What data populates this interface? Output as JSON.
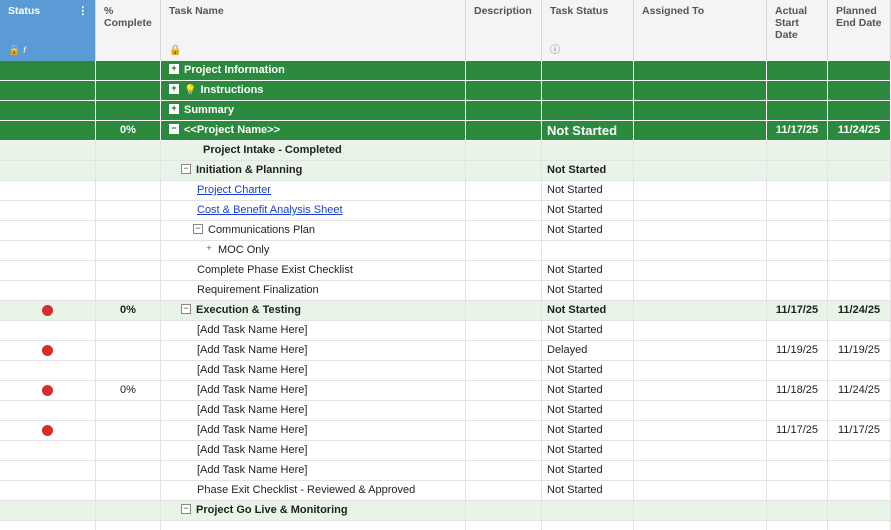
{
  "columns": {
    "status": "Status",
    "pct": "%\nComplete",
    "task": "Task Name",
    "desc": "Description",
    "task_status": "Task Status",
    "assigned": "Assigned To",
    "actual_start": "Actual\nStart\nDate",
    "planned_end": "Planned\nEnd Date"
  },
  "icons": {
    "status_menu": "more-vertical-icon",
    "lock": "lock-icon",
    "formula": "fx-icon",
    "info": "info-icon",
    "status_dot_color": "#d32f2f"
  },
  "colors": {
    "status_header": "#5b9bd5",
    "section_green": "#2b8a3e",
    "light_green": "#e8f4e8"
  },
  "rows": [
    {
      "style": "green",
      "indent": 0,
      "toggle": "+",
      "name": "Project Information",
      "bold": true,
      "status": "",
      "pct": "",
      "start": "",
      "end": ""
    },
    {
      "style": "green",
      "indent": 0,
      "toggle": "+",
      "bulb": true,
      "name": "Instructions",
      "bold": true,
      "status": "",
      "pct": "",
      "start": "",
      "end": ""
    },
    {
      "style": "green",
      "indent": 0,
      "toggle": "+",
      "name": "Summary",
      "bold": true,
      "status": "",
      "pct": "",
      "start": "",
      "end": ""
    },
    {
      "style": "green",
      "indent": 0,
      "toggle": "−",
      "name": "<<Project Name>>",
      "bold": true,
      "status": "Not Started",
      "status_big": true,
      "pct": "0%",
      "start": "11/17/25",
      "end": "11/24/25"
    },
    {
      "style": "light",
      "indent": 1,
      "toggle": "",
      "name": "Project Intake - Completed",
      "bold": true,
      "status": "",
      "pct": "",
      "start": "",
      "end": ""
    },
    {
      "style": "light",
      "indent": 1,
      "toggle": "−",
      "name": "Initiation & Planning",
      "bold": true,
      "status": "Not Started",
      "status_bold": true,
      "pct": "",
      "start": "",
      "end": ""
    },
    {
      "style": "white",
      "indent": 2,
      "toggle": "",
      "name": "Project Charter",
      "link": true,
      "status": "Not Started",
      "pct": "",
      "start": "",
      "end": ""
    },
    {
      "style": "white",
      "indent": 2,
      "toggle": "",
      "name": "Cost & Benefit Analysis Sheet",
      "link": true,
      "status": "Not Started",
      "pct": "",
      "start": "",
      "end": ""
    },
    {
      "style": "white",
      "indent": 2,
      "toggle": "−",
      "name": "Communications Plan",
      "status": "Not Started",
      "pct": "",
      "start": "",
      "end": ""
    },
    {
      "style": "white",
      "indent": 3,
      "toggle": "+",
      "toggle_plain": true,
      "name": "MOC Only",
      "status": "",
      "pct": "",
      "start": "",
      "end": ""
    },
    {
      "style": "white",
      "indent": 2,
      "toggle": "",
      "name": "Complete Phase Exist Checklist",
      "status": "Not Started",
      "pct": "",
      "start": "",
      "end": ""
    },
    {
      "style": "white",
      "indent": 2,
      "toggle": "",
      "name": "Requirement Finalization",
      "status": "Not Started",
      "pct": "",
      "start": "",
      "end": ""
    },
    {
      "style": "light",
      "indent": 1,
      "toggle": "−",
      "name": "Execution & Testing",
      "bold": true,
      "dot": true,
      "status": "Not Started",
      "status_bold": true,
      "pct": "0%",
      "pct_bold": true,
      "start": "11/17/25",
      "end": "11/24/25",
      "date_bold": true
    },
    {
      "style": "white",
      "indent": 2,
      "toggle": "",
      "name": "[Add Task Name Here]",
      "status": "Not Started",
      "pct": "",
      "start": "",
      "end": ""
    },
    {
      "style": "white",
      "indent": 2,
      "toggle": "",
      "name": "[Add Task Name Here]",
      "dot": true,
      "status": "Delayed",
      "pct": "",
      "start": "11/19/25",
      "end": "11/19/25"
    },
    {
      "style": "white",
      "indent": 2,
      "toggle": "",
      "name": "[Add Task Name Here]",
      "status": "Not Started",
      "pct": "",
      "start": "",
      "end": ""
    },
    {
      "style": "white",
      "indent": 2,
      "toggle": "",
      "name": "[Add Task Name Here]",
      "dot": true,
      "status": "Not Started",
      "pct": "0%",
      "start": "11/18/25",
      "end": "11/24/25"
    },
    {
      "style": "white",
      "indent": 2,
      "toggle": "",
      "name": "[Add Task Name Here]",
      "status": "Not Started",
      "pct": "",
      "start": "",
      "end": ""
    },
    {
      "style": "white",
      "indent": 2,
      "toggle": "",
      "name": "[Add Task Name Here]",
      "dot": true,
      "status": "Not Started",
      "pct": "",
      "start": "11/17/25",
      "end": "11/17/25"
    },
    {
      "style": "white",
      "indent": 2,
      "toggle": "",
      "name": "[Add Task Name Here]",
      "status": "Not Started",
      "pct": "",
      "start": "",
      "end": ""
    },
    {
      "style": "white",
      "indent": 2,
      "toggle": "",
      "name": "[Add Task Name Here]",
      "status": "Not Started",
      "pct": "",
      "start": "",
      "end": ""
    },
    {
      "style": "white",
      "indent": 2,
      "toggle": "",
      "name": "Phase Exit Checklist - Reviewed & Approved",
      "status": "Not Started",
      "pct": "",
      "start": "",
      "end": ""
    },
    {
      "style": "light",
      "indent": 1,
      "toggle": "−",
      "name": "Project Go Live & Monitoring",
      "bold": true,
      "status": "",
      "pct": "",
      "start": "",
      "end": ""
    },
    {
      "style": "white",
      "indent": 2,
      "toggle": "",
      "name": "",
      "status": "",
      "pct": "",
      "start": "",
      "end": ""
    }
  ]
}
